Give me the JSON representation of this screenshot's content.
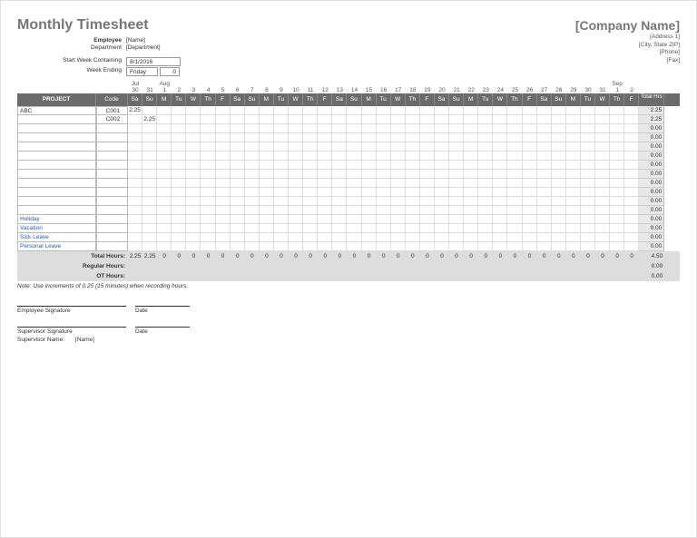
{
  "title": "Monthly Timesheet",
  "company": {
    "name": "[Company Name]",
    "address1": "[Address 1]",
    "address2": "[City, State ZIP]",
    "phone": "[Phone]",
    "fax": "[Fax]"
  },
  "info": {
    "employee_label": "Employee",
    "employee_value": "[Name]",
    "department_label": "Department",
    "department_value": "[Department]",
    "start_week_label": "Start Week Containing",
    "start_week_value": "8/1/2016",
    "week_ending_label": "Week Ending",
    "week_ending_day": "Friday",
    "week_ending_num": "0"
  },
  "months": {
    "m1": "Jul",
    "m2": "Aug",
    "m3": "Sep"
  },
  "day_nums": [
    "30",
    "31",
    "1",
    "2",
    "3",
    "4",
    "5",
    "6",
    "7",
    "8",
    "9",
    "10",
    "11",
    "12",
    "13",
    "14",
    "15",
    "16",
    "17",
    "18",
    "19",
    "20",
    "21",
    "22",
    "23",
    "24",
    "25",
    "26",
    "27",
    "28",
    "29",
    "30",
    "31",
    "1",
    "2"
  ],
  "day_names": [
    "Sa",
    "Su",
    "M",
    "Tu",
    "W",
    "Th",
    "F",
    "Sa",
    "Su",
    "M",
    "Tu",
    "W",
    "Th",
    "F",
    "Sa",
    "Su",
    "M",
    "Tu",
    "W",
    "Th",
    "F",
    "Sa",
    "Su",
    "M",
    "Tu",
    "W",
    "Th",
    "F",
    "Sa",
    "Su",
    "M",
    "Tu",
    "W",
    "Th",
    "F"
  ],
  "headers": {
    "project": "PROJECT",
    "code": "Code",
    "total": "Total Hrs"
  },
  "rows": [
    {
      "project": "ABC",
      "code": "C001",
      "cells": [
        "2.25",
        "",
        "",
        "",
        "",
        "",
        "",
        "",
        "",
        "",
        "",
        "",
        "",
        "",
        "",
        "",
        "",
        "",
        "",
        "",
        "",
        "",
        "",
        "",
        "",
        "",
        "",
        "",
        "",
        "",
        "",
        "",
        "",
        "",
        ""
      ],
      "total": "2.25"
    },
    {
      "project": "",
      "code": "C002",
      "cells": [
        "",
        "2.25",
        "",
        "",
        "",
        "",
        "",
        "",
        "",
        "",
        "",
        "",
        "",
        "",
        "",
        "",
        "",
        "",
        "",
        "",
        "",
        "",
        "",
        "",
        "",
        "",
        "",
        "",
        "",
        "",
        "",
        "",
        "",
        "",
        ""
      ],
      "total": "2.25"
    },
    {
      "project": "",
      "code": "",
      "cells": [
        "",
        "",
        "",
        "",
        "",
        "",
        "",
        "",
        "",
        "",
        "",
        "",
        "",
        "",
        "",
        "",
        "",
        "",
        "",
        "",
        "",
        "",
        "",
        "",
        "",
        "",
        "",
        "",
        "",
        "",
        "",
        "",
        "",
        "",
        ""
      ],
      "total": "0.00"
    },
    {
      "project": "",
      "code": "",
      "cells": [
        "",
        "",
        "",
        "",
        "",
        "",
        "",
        "",
        "",
        "",
        "",
        "",
        "",
        "",
        "",
        "",
        "",
        "",
        "",
        "",
        "",
        "",
        "",
        "",
        "",
        "",
        "",
        "",
        "",
        "",
        "",
        "",
        "",
        "",
        ""
      ],
      "total": "0.00"
    },
    {
      "project": "",
      "code": "",
      "cells": [
        "",
        "",
        "",
        "",
        "",
        "",
        "",
        "",
        "",
        "",
        "",
        "",
        "",
        "",
        "",
        "",
        "",
        "",
        "",
        "",
        "",
        "",
        "",
        "",
        "",
        "",
        "",
        "",
        "",
        "",
        "",
        "",
        "",
        "",
        ""
      ],
      "total": "0.00"
    },
    {
      "project": "",
      "code": "",
      "cells": [
        "",
        "",
        "",
        "",
        "",
        "",
        "",
        "",
        "",
        "",
        "",
        "",
        "",
        "",
        "",
        "",
        "",
        "",
        "",
        "",
        "",
        "",
        "",
        "",
        "",
        "",
        "",
        "",
        "",
        "",
        "",
        "",
        "",
        "",
        ""
      ],
      "total": "0.00"
    },
    {
      "project": "",
      "code": "",
      "cells": [
        "",
        "",
        "",
        "",
        "",
        "",
        "",
        "",
        "",
        "",
        "",
        "",
        "",
        "",
        "",
        "",
        "",
        "",
        "",
        "",
        "",
        "",
        "",
        "",
        "",
        "",
        "",
        "",
        "",
        "",
        "",
        "",
        "",
        "",
        ""
      ],
      "total": "0.00"
    },
    {
      "project": "",
      "code": "",
      "cells": [
        "",
        "",
        "",
        "",
        "",
        "",
        "",
        "",
        "",
        "",
        "",
        "",
        "",
        "",
        "",
        "",
        "",
        "",
        "",
        "",
        "",
        "",
        "",
        "",
        "",
        "",
        "",
        "",
        "",
        "",
        "",
        "",
        "",
        "",
        ""
      ],
      "total": "0.00"
    },
    {
      "project": "",
      "code": "",
      "cells": [
        "",
        "",
        "",
        "",
        "",
        "",
        "",
        "",
        "",
        "",
        "",
        "",
        "",
        "",
        "",
        "",
        "",
        "",
        "",
        "",
        "",
        "",
        "",
        "",
        "",
        "",
        "",
        "",
        "",
        "",
        "",
        "",
        "",
        "",
        ""
      ],
      "total": "0.00"
    },
    {
      "project": "",
      "code": "",
      "cells": [
        "",
        "",
        "",
        "",
        "",
        "",
        "",
        "",
        "",
        "",
        "",
        "",
        "",
        "",
        "",
        "",
        "",
        "",
        "",
        "",
        "",
        "",
        "",
        "",
        "",
        "",
        "",
        "",
        "",
        "",
        "",
        "",
        "",
        "",
        ""
      ],
      "total": "0.00"
    },
    {
      "project": "",
      "code": "",
      "cells": [
        "",
        "",
        "",
        "",
        "",
        "",
        "",
        "",
        "",
        "",
        "",
        "",
        "",
        "",
        "",
        "",
        "",
        "",
        "",
        "",
        "",
        "",
        "",
        "",
        "",
        "",
        "",
        "",
        "",
        "",
        "",
        "",
        "",
        "",
        ""
      ],
      "total": "0.00"
    },
    {
      "project": "",
      "code": "",
      "cells": [
        "",
        "",
        "",
        "",
        "",
        "",
        "",
        "",
        "",
        "",
        "",
        "",
        "",
        "",
        "",
        "",
        "",
        "",
        "",
        "",
        "",
        "",
        "",
        "",
        "",
        "",
        "",
        "",
        "",
        "",
        "",
        "",
        "",
        "",
        ""
      ],
      "total": "0.00"
    },
    {
      "project": "Holiday",
      "code": "",
      "link": true,
      "cells": [
        "",
        "",
        "",
        "",
        "",
        "",
        "",
        "",
        "",
        "",
        "",
        "",
        "",
        "",
        "",
        "",
        "",
        "",
        "",
        "",
        "",
        "",
        "",
        "",
        "",
        "",
        "",
        "",
        "",
        "",
        "",
        "",
        "",
        "",
        ""
      ],
      "total": "0.00"
    },
    {
      "project": "Vacation",
      "code": "",
      "link": true,
      "cells": [
        "",
        "",
        "",
        "",
        "",
        "",
        "",
        "",
        "",
        "",
        "",
        "",
        "",
        "",
        "",
        "",
        "",
        "",
        "",
        "",
        "",
        "",
        "",
        "",
        "",
        "",
        "",
        "",
        "",
        "",
        "",
        "",
        "",
        "",
        ""
      ],
      "total": "0.00"
    },
    {
      "project": "Sick Leave",
      "code": "",
      "link": true,
      "cells": [
        "",
        "",
        "",
        "",
        "",
        "",
        "",
        "",
        "",
        "",
        "",
        "",
        "",
        "",
        "",
        "",
        "",
        "",
        "",
        "",
        "",
        "",
        "",
        "",
        "",
        "",
        "",
        "",
        "",
        "",
        "",
        "",
        "",
        "",
        ""
      ],
      "total": "0.00"
    },
    {
      "project": "Personal Leave",
      "code": "",
      "link": true,
      "cells": [
        "",
        "",
        "",
        "",
        "",
        "",
        "",
        "",
        "",
        "",
        "",
        "",
        "",
        "",
        "",
        "",
        "",
        "",
        "",
        "",
        "",
        "",
        "",
        "",
        "",
        "",
        "",
        "",
        "",
        "",
        "",
        "",
        "",
        "",
        ""
      ],
      "total": "0.00"
    }
  ],
  "totals": {
    "total_label": "Total Hours:",
    "total_cells": [
      "2.25",
      "2.25",
      "0",
      "0",
      "0",
      "0",
      "0",
      "0",
      "0",
      "0",
      "0",
      "0",
      "0",
      "0",
      "0",
      "0",
      "0",
      "0",
      "0",
      "0",
      "0",
      "0",
      "0",
      "0",
      "0",
      "0",
      "0",
      "0",
      "0",
      "0",
      "0",
      "0",
      "0",
      "0",
      "0"
    ],
    "total_sum": "4.50",
    "regular_label": "Regular Hours:",
    "regular_sum": "0.00",
    "ot_label": "OT Hours:",
    "ot_sum": "0.00"
  },
  "note": "Note: Use increments of 0.25 (15 minutes) when recording hours.",
  "sig": {
    "emp": "Employee Signature",
    "date": "Date",
    "sup": "Supervisor Signature",
    "sup_name_label": "Supervisor Name:",
    "sup_name_value": "[Name]"
  }
}
